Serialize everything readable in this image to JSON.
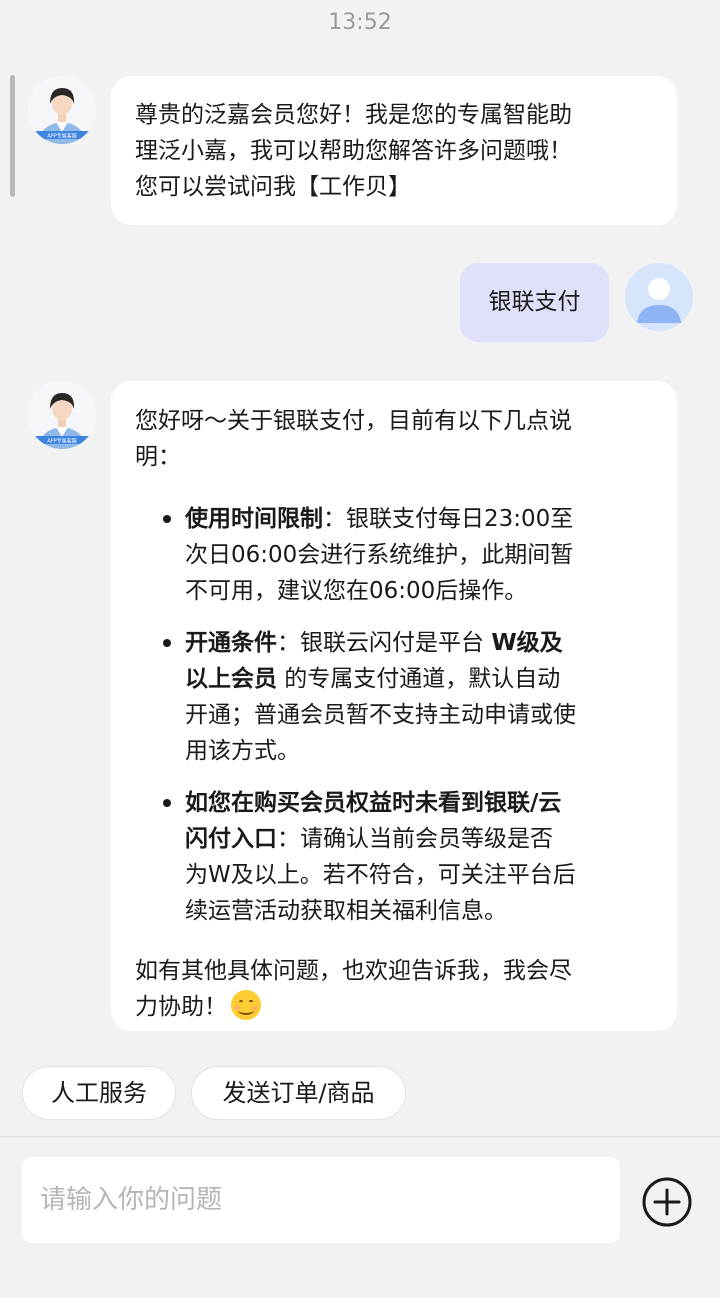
{
  "status_bar": {
    "time": "13:52"
  },
  "bot_avatar_badge": "APP专属客服",
  "messages": [
    {
      "role": "assistant",
      "lines": [
        "尊贵的泛嘉会员您好！我是您的专属智能助",
        "理泛小嘉，我可以帮助您解答许多问题哦！",
        "您可以尝试问我【工作贝】"
      ]
    },
    {
      "role": "user",
      "text": "银联支付"
    },
    {
      "role": "assistant",
      "intro_lines": [
        "您好呀～关于银联支付，目前有以下几点说",
        "明："
      ],
      "bullets": [
        {
          "title": "使用时间限制",
          "lines": [
            "：银联支付每日23:00至",
            "次日06:00会进行系统维护，此期间暂",
            "不可用，建议您在06:00后操作。"
          ]
        },
        {
          "title": "开通条件",
          "pre": "：银联云闪付是平台 ",
          "emph1": "W级及",
          "emph2": "以上会员",
          "post_lines": [
            " 的专属支付通道，默认自动",
            "开通；普通会员暂不支持主动申请或使",
            "用该方式。"
          ]
        },
        {
          "title_lines": [
            "如您在购买会员权益时未看到银联/云",
            "闪付入口"
          ],
          "lines": [
            "：请确认当前会员等级是否",
            "为W及以上。若不符合，可关注平台后",
            "续运营活动获取相关福利信息。"
          ]
        }
      ],
      "outro_lines": [
        "如有其他具体问题，也欢迎告诉我，我会尽",
        "力协助！"
      ],
      "emoji": "smiling-face"
    }
  ],
  "quick_actions": [
    "人工服务",
    "发送订单/商品"
  ],
  "input": {
    "placeholder": "请输入你的问题"
  },
  "colors": {
    "background": "#f2f2f2",
    "user_bubble": "#dfe1fb",
    "user_avatar": "#8fb4f6"
  }
}
